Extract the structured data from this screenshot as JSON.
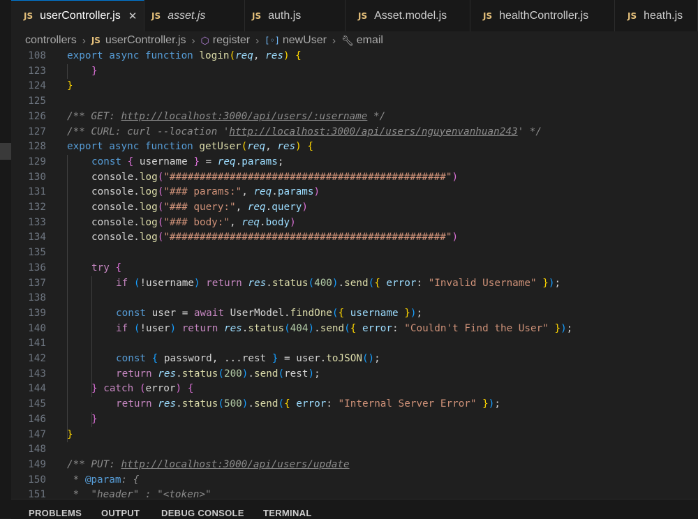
{
  "tabs": [
    {
      "label": "userController.js",
      "active": true,
      "italic": false
    },
    {
      "label": "asset.js",
      "active": false,
      "italic": true
    },
    {
      "label": "auth.js",
      "active": false,
      "italic": false
    },
    {
      "label": "Asset.model.js",
      "active": false,
      "italic": false
    },
    {
      "label": "healthController.js",
      "active": false,
      "italic": false
    },
    {
      "label": "heath.js",
      "active": false,
      "italic": false
    }
  ],
  "js_badge": "JS",
  "tab_close_glyph": "✕",
  "breadcrumb": {
    "folder": "controllers",
    "file": "userController.js",
    "method": "register",
    "variable": "newUser",
    "property": "email"
  },
  "colors": {
    "keyword": "#569cd6",
    "control": "#c586c0",
    "function": "#dcdcaa",
    "string": "#ce9178",
    "variable": "#9cdcfe",
    "number": "#b5cea8",
    "comment": "#8b8b8b",
    "bracket_gold": "#ffd700",
    "bracket_purple": "#da70d6",
    "bracket_blue": "#179fff",
    "js_icon": "#e5c07b",
    "accent": "#0078d4"
  },
  "code_lines": [
    {
      "n": "108",
      "indent": 0,
      "t": [
        [
          "kw",
          "export"
        ],
        [
          "pn",
          " "
        ],
        [
          "kw",
          "async"
        ],
        [
          "pn",
          " "
        ],
        [
          "kw",
          "function"
        ],
        [
          "pn",
          " "
        ],
        [
          "fn",
          "login"
        ],
        [
          "br1",
          "("
        ],
        [
          "prm",
          "req"
        ],
        [
          "pn",
          ", "
        ],
        [
          "prm",
          "res"
        ],
        [
          "br1",
          ")"
        ],
        [
          "pn",
          " "
        ],
        [
          "br1",
          "{"
        ]
      ]
    },
    {
      "n": "123",
      "indent": 1,
      "t": [
        [
          "br2",
          "}"
        ]
      ]
    },
    {
      "n": "124",
      "indent": 0,
      "t": [
        [
          "br1",
          "}"
        ]
      ]
    },
    {
      "n": "125",
      "indent": 0,
      "t": []
    },
    {
      "n": "126",
      "indent": 0,
      "t": [
        [
          "cm",
          "/** GET: "
        ],
        [
          "cmu",
          "http://localhost:3000/api/users/:username"
        ],
        [
          "cm",
          " */"
        ]
      ]
    },
    {
      "n": "127",
      "indent": 0,
      "t": [
        [
          "cm",
          "/** CURL: curl --location '"
        ],
        [
          "cmu",
          "http://localhost:3000/api/users/nguyenvanhuan243"
        ],
        [
          "cm",
          "' */"
        ]
      ]
    },
    {
      "n": "128",
      "indent": 0,
      "t": [
        [
          "kw",
          "export"
        ],
        [
          "pn",
          " "
        ],
        [
          "kw",
          "async"
        ],
        [
          "pn",
          " "
        ],
        [
          "kw",
          "function"
        ],
        [
          "pn",
          " "
        ],
        [
          "fn",
          "getUser"
        ],
        [
          "br1",
          "("
        ],
        [
          "prm",
          "req"
        ],
        [
          "pn",
          ", "
        ],
        [
          "prm",
          "res"
        ],
        [
          "br1",
          ")"
        ],
        [
          "pn",
          " "
        ],
        [
          "br1",
          "{"
        ]
      ]
    },
    {
      "n": "129",
      "indent": 1,
      "t": [
        [
          "kw",
          "const"
        ],
        [
          "pn",
          " "
        ],
        [
          "br2",
          "{"
        ],
        [
          "pn",
          " username "
        ],
        [
          "br2",
          "}"
        ],
        [
          "pn",
          " = "
        ],
        [
          "prm",
          "req"
        ],
        [
          "pn",
          "."
        ],
        [
          "prop",
          "params"
        ],
        [
          "pn",
          ";"
        ]
      ]
    },
    {
      "n": "130",
      "indent": 1,
      "t": [
        [
          "pn",
          "console."
        ],
        [
          "fn",
          "log"
        ],
        [
          "br2",
          "("
        ],
        [
          "str",
          "\"##############################################\""
        ],
        [
          "br2",
          ")"
        ]
      ]
    },
    {
      "n": "131",
      "indent": 1,
      "t": [
        [
          "pn",
          "console."
        ],
        [
          "fn",
          "log"
        ],
        [
          "br2",
          "("
        ],
        [
          "str",
          "\"### params:\""
        ],
        [
          "pn",
          ", "
        ],
        [
          "prm",
          "req"
        ],
        [
          "pn",
          "."
        ],
        [
          "prop",
          "params"
        ],
        [
          "br2",
          ")"
        ]
      ]
    },
    {
      "n": "132",
      "indent": 1,
      "t": [
        [
          "pn",
          "console."
        ],
        [
          "fn",
          "log"
        ],
        [
          "br2",
          "("
        ],
        [
          "str",
          "\"### query:\""
        ],
        [
          "pn",
          ", "
        ],
        [
          "prm",
          "req"
        ],
        [
          "pn",
          "."
        ],
        [
          "prop",
          "query"
        ],
        [
          "br2",
          ")"
        ]
      ]
    },
    {
      "n": "133",
      "indent": 1,
      "t": [
        [
          "pn",
          "console."
        ],
        [
          "fn",
          "log"
        ],
        [
          "br2",
          "("
        ],
        [
          "str",
          "\"### body:\""
        ],
        [
          "pn",
          ", "
        ],
        [
          "prm",
          "req"
        ],
        [
          "pn",
          "."
        ],
        [
          "prop",
          "body"
        ],
        [
          "br2",
          ")"
        ]
      ]
    },
    {
      "n": "134",
      "indent": 1,
      "t": [
        [
          "pn",
          "console."
        ],
        [
          "fn",
          "log"
        ],
        [
          "br2",
          "("
        ],
        [
          "str",
          "\"##############################################\""
        ],
        [
          "br2",
          ")"
        ]
      ]
    },
    {
      "n": "135",
      "indent": 0,
      "t": []
    },
    {
      "n": "136",
      "indent": 1,
      "t": [
        [
          "ctrl",
          "try"
        ],
        [
          "pn",
          " "
        ],
        [
          "br2",
          "{"
        ]
      ]
    },
    {
      "n": "137",
      "indent": 2,
      "t": [
        [
          "ctrl",
          "if"
        ],
        [
          "pn",
          " "
        ],
        [
          "br3",
          "("
        ],
        [
          "pn",
          "!username"
        ],
        [
          "br3",
          ")"
        ],
        [
          "pn",
          " "
        ],
        [
          "ctrl",
          "return"
        ],
        [
          "pn",
          " "
        ],
        [
          "prm",
          "res"
        ],
        [
          "pn",
          "."
        ],
        [
          "fn",
          "status"
        ],
        [
          "br3",
          "("
        ],
        [
          "num",
          "400"
        ],
        [
          "br3",
          ")"
        ],
        [
          "pn",
          "."
        ],
        [
          "fn",
          "send"
        ],
        [
          "br3",
          "("
        ],
        [
          "br1",
          "{"
        ],
        [
          "pn",
          " "
        ],
        [
          "prop",
          "error"
        ],
        [
          "pn",
          ": "
        ],
        [
          "str",
          "\"Invalid Username\""
        ],
        [
          "pn",
          " "
        ],
        [
          "br1",
          "}"
        ],
        [
          "br3",
          ")"
        ],
        [
          "pn",
          ";"
        ]
      ]
    },
    {
      "n": "138",
      "indent": 0,
      "t": []
    },
    {
      "n": "139",
      "indent": 2,
      "t": [
        [
          "kw",
          "const"
        ],
        [
          "pn",
          " user = "
        ],
        [
          "ctrl",
          "await"
        ],
        [
          "pn",
          " UserModel."
        ],
        [
          "fn",
          "findOne"
        ],
        [
          "br3",
          "("
        ],
        [
          "br1",
          "{"
        ],
        [
          "pn",
          " "
        ],
        [
          "prop",
          "username"
        ],
        [
          "pn",
          " "
        ],
        [
          "br1",
          "}"
        ],
        [
          "br3",
          ")"
        ],
        [
          "pn",
          ";"
        ]
      ]
    },
    {
      "n": "140",
      "indent": 2,
      "t": [
        [
          "ctrl",
          "if"
        ],
        [
          "pn",
          " "
        ],
        [
          "br3",
          "("
        ],
        [
          "pn",
          "!user"
        ],
        [
          "br3",
          ")"
        ],
        [
          "pn",
          " "
        ],
        [
          "ctrl",
          "return"
        ],
        [
          "pn",
          " "
        ],
        [
          "prm",
          "res"
        ],
        [
          "pn",
          "."
        ],
        [
          "fn",
          "status"
        ],
        [
          "br3",
          "("
        ],
        [
          "num",
          "404"
        ],
        [
          "br3",
          ")"
        ],
        [
          "pn",
          "."
        ],
        [
          "fn",
          "send"
        ],
        [
          "br3",
          "("
        ],
        [
          "br1",
          "{"
        ],
        [
          "pn",
          " "
        ],
        [
          "prop",
          "error"
        ],
        [
          "pn",
          ": "
        ],
        [
          "str",
          "\"Couldn't Find the User\""
        ],
        [
          "pn",
          " "
        ],
        [
          "br1",
          "}"
        ],
        [
          "br3",
          ")"
        ],
        [
          "pn",
          ";"
        ]
      ]
    },
    {
      "n": "141",
      "indent": 0,
      "t": []
    },
    {
      "n": "142",
      "indent": 2,
      "t": [
        [
          "kw",
          "const"
        ],
        [
          "pn",
          " "
        ],
        [
          "br3",
          "{"
        ],
        [
          "pn",
          " password, ...rest "
        ],
        [
          "br3",
          "}"
        ],
        [
          "pn",
          " = user."
        ],
        [
          "fn",
          "toJSON"
        ],
        [
          "br3",
          "()"
        ],
        [
          "pn",
          ";"
        ]
      ]
    },
    {
      "n": "143",
      "indent": 2,
      "t": [
        [
          "ctrl",
          "return"
        ],
        [
          "pn",
          " "
        ],
        [
          "prm",
          "res"
        ],
        [
          "pn",
          "."
        ],
        [
          "fn",
          "status"
        ],
        [
          "br3",
          "("
        ],
        [
          "num",
          "200"
        ],
        [
          "br3",
          ")"
        ],
        [
          "pn",
          "."
        ],
        [
          "fn",
          "send"
        ],
        [
          "br3",
          "("
        ],
        [
          "pn",
          "rest"
        ],
        [
          "br3",
          ")"
        ],
        [
          "pn",
          ";"
        ]
      ]
    },
    {
      "n": "144",
      "indent": 1,
      "t": [
        [
          "br2",
          "}"
        ],
        [
          "pn",
          " "
        ],
        [
          "ctrl",
          "catch"
        ],
        [
          "pn",
          " "
        ],
        [
          "br2",
          "("
        ],
        [
          "pn",
          "error"
        ],
        [
          "br2",
          ")"
        ],
        [
          "pn",
          " "
        ],
        [
          "br2",
          "{"
        ]
      ]
    },
    {
      "n": "145",
      "indent": 2,
      "t": [
        [
          "ctrl",
          "return"
        ],
        [
          "pn",
          " "
        ],
        [
          "prm",
          "res"
        ],
        [
          "pn",
          "."
        ],
        [
          "fn",
          "status"
        ],
        [
          "br3",
          "("
        ],
        [
          "num",
          "500"
        ],
        [
          "br3",
          ")"
        ],
        [
          "pn",
          "."
        ],
        [
          "fn",
          "send"
        ],
        [
          "br3",
          "("
        ],
        [
          "br1",
          "{"
        ],
        [
          "pn",
          " "
        ],
        [
          "prop",
          "error"
        ],
        [
          "pn",
          ": "
        ],
        [
          "str",
          "\"Internal Server Error\""
        ],
        [
          "pn",
          " "
        ],
        [
          "br1",
          "}"
        ],
        [
          "br3",
          ")"
        ],
        [
          "pn",
          ";"
        ]
      ]
    },
    {
      "n": "146",
      "indent": 1,
      "t": [
        [
          "br2",
          "}"
        ]
      ]
    },
    {
      "n": "147",
      "indent": 0,
      "t": [
        [
          "br1",
          "}"
        ]
      ]
    },
    {
      "n": "148",
      "indent": 0,
      "t": []
    },
    {
      "n": "149",
      "indent": 0,
      "t": [
        [
          "cm",
          "/** PUT: "
        ],
        [
          "cmu",
          "http://localhost:3000/api/users/update"
        ]
      ]
    },
    {
      "n": "150",
      "indent": 0,
      "t": [
        [
          "cm",
          " * "
        ],
        [
          "tag",
          "@param"
        ],
        [
          "cm",
          ": {"
        ]
      ]
    },
    {
      "n": "151",
      "indent": 0,
      "t": [
        [
          "cm",
          " *  \"header\" : \"<token>\""
        ]
      ]
    }
  ],
  "panel_tabs": [
    "PROBLEMS",
    "OUTPUT",
    "DEBUG CONSOLE",
    "TERMINAL"
  ]
}
